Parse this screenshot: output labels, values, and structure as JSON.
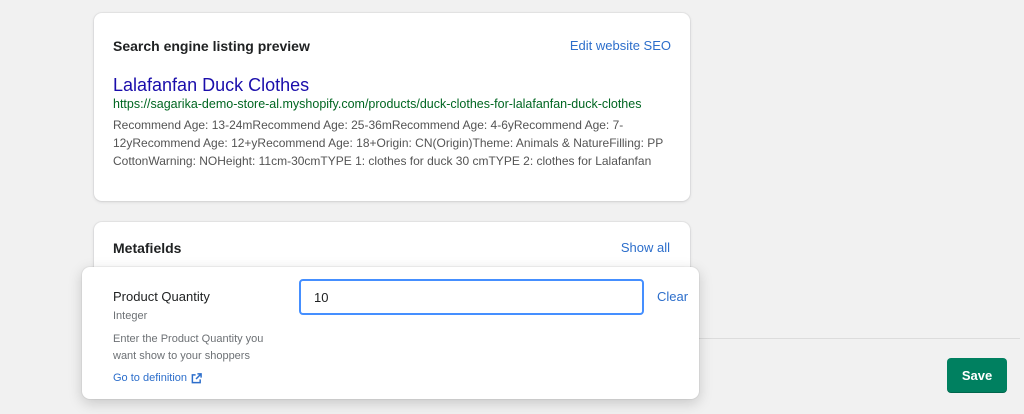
{
  "seo": {
    "title": "Search engine listing preview",
    "edit_link": "Edit website SEO",
    "preview_title": "Lalafanfan Duck Clothes",
    "preview_url": "https://sagarika-demo-store-al.myshopify.com/products/duck-clothes-for-lalafanfan-duck-clothes",
    "preview_description": "Recommend Age: 13-24mRecommend Age: 25-36mRecommend Age: 4-6yRecommend Age: 7-12yRecommend Age: 12+yRecommend Age: 18+Origin: CN(Origin)Theme: Animals & NatureFilling: PP CottonWarning: NOHeight: 11cm-30cmTYPE 1: clothes for duck 30 cmTYPE 2: clothes for Lalafanfan"
  },
  "metafields": {
    "title": "Metafields",
    "show_all": "Show all"
  },
  "metafield_editor": {
    "name": "Product Quantity",
    "type": "Integer",
    "help": "Enter the Product Quantity you want show to your shoppers",
    "definition_link": "Go to definition",
    "value": "10",
    "clear": "Clear"
  },
  "actions": {
    "save": "Save"
  },
  "icons": {
    "external_link": "external-link-icon"
  },
  "colors": {
    "primary": "#008060",
    "link": "#2c6ecb",
    "focus": "#458fff",
    "preview_title": "#1a0dab",
    "preview_url": "#006621"
  }
}
